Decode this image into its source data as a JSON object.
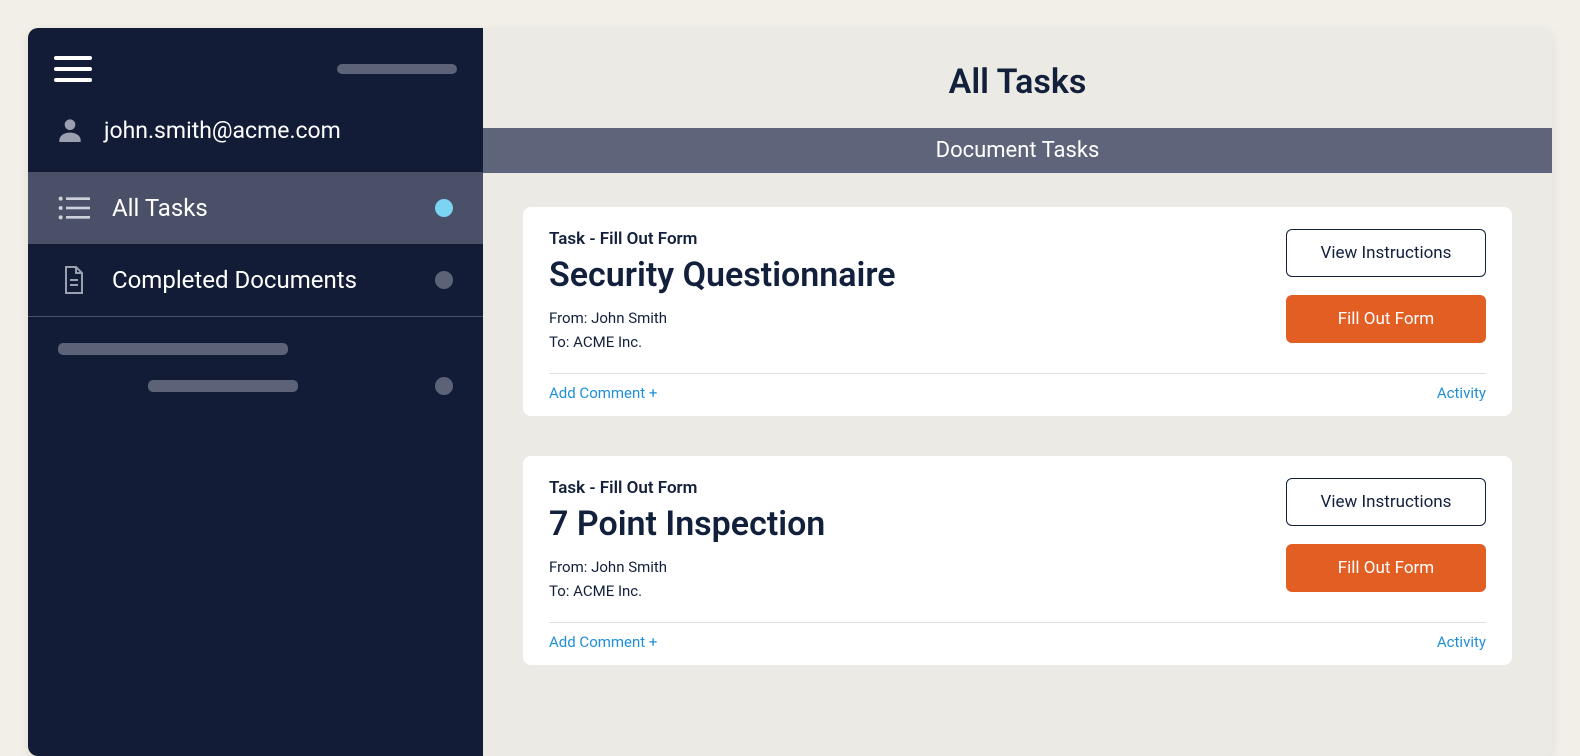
{
  "sidebar": {
    "user_email": "john.smith@acme.com",
    "nav": [
      {
        "label": "All Tasks",
        "active": true,
        "dot": "blue"
      },
      {
        "label": "Completed Documents",
        "active": false,
        "dot": "grey"
      }
    ]
  },
  "page": {
    "title": "All Tasks",
    "subheader": "Document Tasks"
  },
  "tasks": [
    {
      "type_label": "Task - Fill Out Form",
      "title": "Security Questionnaire",
      "from_label": "From: John Smith",
      "to_label": "To: ACME Inc.",
      "view_instructions": "View Instructions",
      "fill_out": "Fill Out Form",
      "add_comment": "Add Comment +",
      "activity": "Activity"
    },
    {
      "type_label": "Task - Fill Out Form",
      "title": "7 Point Inspection",
      "from_label": "From: John Smith",
      "to_label": "To: ACME Inc.",
      "view_instructions": "View Instructions",
      "fill_out": "Fill Out Form",
      "add_comment": "Add Comment +",
      "activity": "Activity"
    }
  ]
}
